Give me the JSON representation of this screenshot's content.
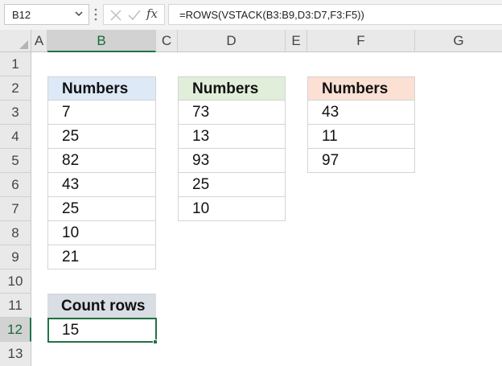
{
  "formula_bar": {
    "name_box": "B12",
    "fx_label": "fx",
    "formula": "=ROWS(VSTACK(B3:B9,D3:D7,F3:F5))"
  },
  "columns": [
    "A",
    "B",
    "C",
    "D",
    "E",
    "F",
    "G"
  ],
  "rows": [
    "1",
    "2",
    "3",
    "4",
    "5",
    "6",
    "7",
    "8",
    "9",
    "10",
    "11",
    "12",
    "13"
  ],
  "selected": {
    "column": "B",
    "row": "12"
  },
  "tables": {
    "b": {
      "header": "Numbers",
      "values": [
        "7",
        "25",
        "82",
        "43",
        "25",
        "10",
        "21"
      ]
    },
    "d": {
      "header": "Numbers",
      "values": [
        "73",
        "13",
        "93",
        "25",
        "10"
      ]
    },
    "f": {
      "header": "Numbers",
      "values": [
        "43",
        "11",
        "97"
      ]
    }
  },
  "result": {
    "label": "Count rows",
    "value": "15"
  },
  "colors": {
    "accent": "#217346",
    "header_b": "#dde9f6",
    "header_d": "#e1eed9",
    "header_f": "#fbe0d3",
    "header_result": "#d9dde4"
  },
  "icons": [
    "chevron-down-icon",
    "more-options-icon",
    "cancel-icon",
    "enter-icon",
    "insert-function-icon"
  ]
}
